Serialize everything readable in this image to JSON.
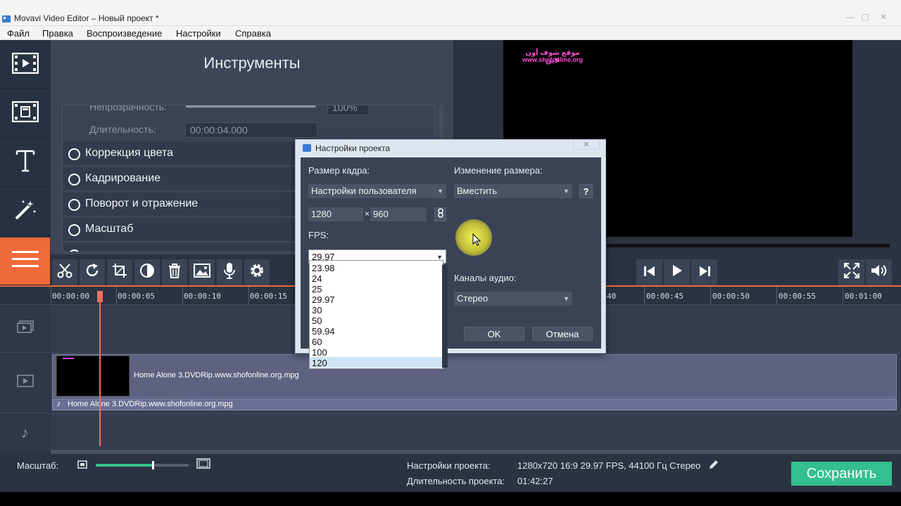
{
  "window": {
    "title": "Movavi Video Editor – Новый проект *",
    "controls": [
      "—",
      "▢",
      "✕"
    ]
  },
  "menu": [
    "Файл",
    "Правка",
    "Воспроизведение",
    "Настройки",
    "Справка"
  ],
  "sidebar": {
    "items": [
      {
        "name": "import",
        "icon": "film-strip-icon"
      },
      {
        "name": "transitions",
        "icon": "clip-transition-icon"
      },
      {
        "name": "titles",
        "icon": "text-icon"
      },
      {
        "name": "filters",
        "icon": "magic-wand-icon"
      },
      {
        "name": "more-tools",
        "icon": "menu-icon",
        "active": true
      }
    ]
  },
  "tools_panel": {
    "heading": "Инструменты",
    "opacity_label": "Непрозрачность:",
    "opacity_value": "100%",
    "duration_label": "Длительность:",
    "duration_value": "00:00:04.000",
    "items": [
      "Коррекция цвета",
      "Кадрирование",
      "Поворот и отражение",
      "Масштаб"
    ]
  },
  "preview": {
    "watermark_line1": "موقع شوف أون لاين",
    "watermark_line2": "www.shofonline.org"
  },
  "timeline_toolbar": {
    "tools": [
      "scissors-icon",
      "rotate-icon",
      "crop-icon",
      "color-adjust-icon",
      "trash-icon",
      "image-icon",
      "microphone-icon",
      "gear-icon"
    ],
    "playback": [
      "skip-back-icon",
      "play-icon",
      "skip-forward-icon"
    ],
    "right": [
      "fullscreen-icon",
      "volume-icon"
    ]
  },
  "ruler": {
    "ticks": [
      "00:00:00",
      "00:00:05",
      "00:00:10",
      "00:00:15",
      "40",
      "00:00:45",
      "00:00:50",
      "00:00:55",
      "00:01:00"
    ]
  },
  "tracks": {
    "video_clip": "Home Alone 3.DVDRip.www.shofonline.org.mpg",
    "audio_clip": "Home Alone 3.DVDRip.www.shofonline.org.mpg"
  },
  "bottom": {
    "zoom_label": "Масштаб:",
    "zoom_level": 0.62,
    "project_settings_label": "Настройки проекта:",
    "project_settings_value": "1280x720 16:9 29.97 FPS, 44100 Гц Стерео",
    "duration_label": "Длительность проекта:",
    "duration_value": "01:42:27",
    "save_label": "Сохранить"
  },
  "dialog": {
    "title": "Настройки проекта",
    "close_label": "✕",
    "frame_size_label": "Размер кадра:",
    "frame_size_value": "Настройки пользователя",
    "width": "1280",
    "times": "×",
    "height": "960",
    "resize_label": "Изменение размера:",
    "resize_value": "Вместить",
    "help_label": "?",
    "fps_label": "FPS:",
    "fps_value": "29.97",
    "fps_options": [
      "23.98",
      "24",
      "25",
      "29.97",
      "30",
      "50",
      "59.94",
      "60",
      "100",
      "120"
    ],
    "fps_highlighted": "120",
    "audio_channels_label": "Каналы аудио:",
    "audio_channels_value": "Стерео",
    "ok_label": "OK",
    "cancel_label": "Отмена"
  },
  "colors": {
    "accent_orange": "#f16a3a",
    "save_green": "#33c08e",
    "panel_bg": "#2b3342"
  }
}
